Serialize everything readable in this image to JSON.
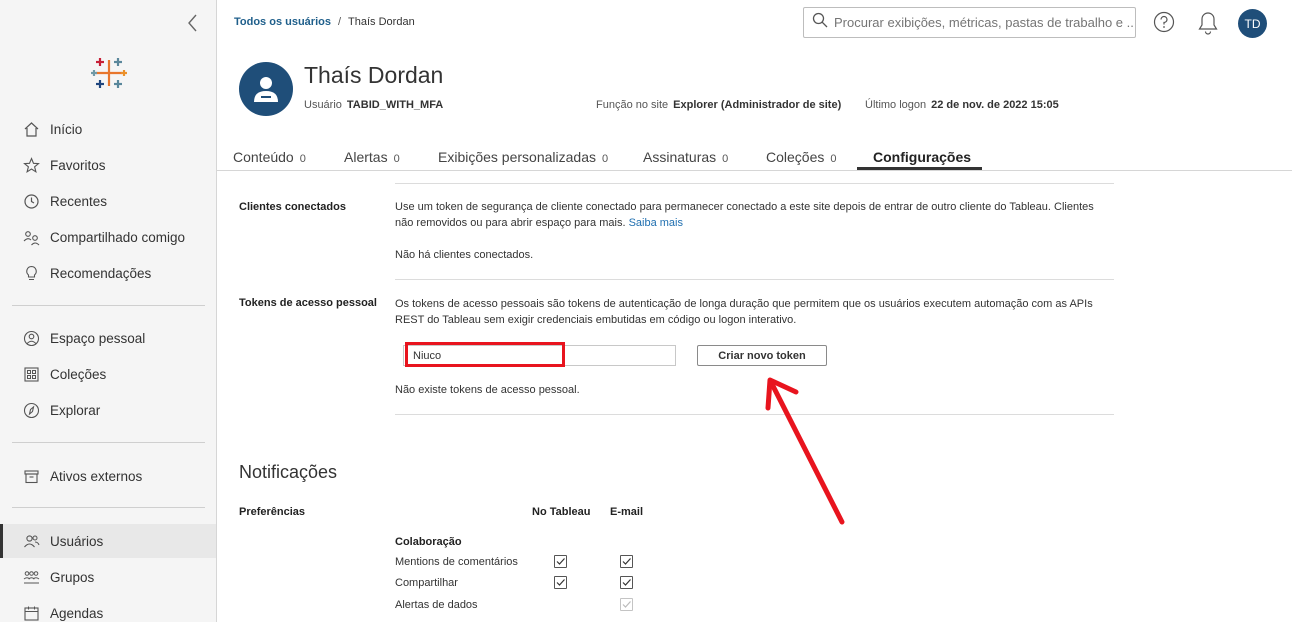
{
  "sidebar": {
    "items_top": [
      {
        "label": "Início",
        "icon": "home-icon"
      },
      {
        "label": "Favoritos",
        "icon": "star-icon"
      },
      {
        "label": "Recentes",
        "icon": "clock-icon"
      },
      {
        "label": "Compartilhado comigo",
        "icon": "shared-icon"
      },
      {
        "label": "Recomendações",
        "icon": "lightbulb-icon"
      }
    ],
    "items_mid": [
      {
        "label": "Espaço pessoal",
        "icon": "personal-space-icon"
      },
      {
        "label": "Coleções",
        "icon": "collections-icon"
      },
      {
        "label": "Explorar",
        "icon": "explore-icon"
      }
    ],
    "items_ext": [
      {
        "label": "Ativos externos",
        "icon": "external-assets-icon"
      }
    ],
    "items_admin": [
      {
        "label": "Usuários",
        "icon": "users-icon",
        "active": true
      },
      {
        "label": "Grupos",
        "icon": "groups-icon"
      },
      {
        "label": "Agendas",
        "icon": "schedules-icon"
      }
    ]
  },
  "breadcrumb": {
    "parent": "Todos os usuários",
    "separator": "/",
    "current": "Thaís Dordan"
  },
  "search": {
    "placeholder": "Procurar exibições, métricas, pastas de trabalho e ..."
  },
  "top_avatar": "TD",
  "profile": {
    "name": "Thaís Dordan",
    "user_label": "Usuário",
    "user_value": "TABID_WITH_MFA\\",
    "role_label": "Função no site",
    "role_value": "Explorer (Administrador de site)",
    "logon_label": "Último logon",
    "logon_value": "22 de nov. de 2022 15:05"
  },
  "tabs": [
    {
      "label": "Conteúdo",
      "count": "0"
    },
    {
      "label": "Alertas",
      "count": "0"
    },
    {
      "label": "Exibições personalizadas",
      "count": "0"
    },
    {
      "label": "Assinaturas",
      "count": "0"
    },
    {
      "label": "Coleções",
      "count": "0"
    },
    {
      "label": "Configurações",
      "count": ""
    }
  ],
  "connected_clients": {
    "label": "Clientes conectados",
    "description": "Use um token de segurança de cliente conectado para permanecer conectado a este site depois de entrar de outro cliente do Tableau. Clientes não removidos ou para abrir espaço para mais.",
    "learn_more": "Saiba mais",
    "empty": "Não há clientes conectados."
  },
  "pat": {
    "label": "Tokens de acesso pessoal",
    "description": "Os tokens de acesso pessoais são tokens de autenticação de longa duração que permitem que os usuários executem automação com as APIs REST do Tableau sem exigir credenciais embutidas em código ou logon interativo.",
    "input_value": "Niuco",
    "create_button": "Criar novo token",
    "empty": "Não existe tokens de acesso pessoal."
  },
  "notifications": {
    "title": "Notificações",
    "preferences_label": "Preferências",
    "col_tableau": "No Tableau",
    "col_email": "E-mail",
    "group": "Colaboração",
    "rows": [
      {
        "label": "Mentions de comentários",
        "tableau": true,
        "email": true
      },
      {
        "label": "Compartilhar",
        "tableau": true,
        "email": true
      },
      {
        "label": "Alertas de dados",
        "tableau": null,
        "email": true,
        "email_disabled": true
      }
    ]
  },
  "colors": {
    "accent": "#1f4e79",
    "link": "#1f6fb0",
    "highlight": "#e8141e"
  }
}
